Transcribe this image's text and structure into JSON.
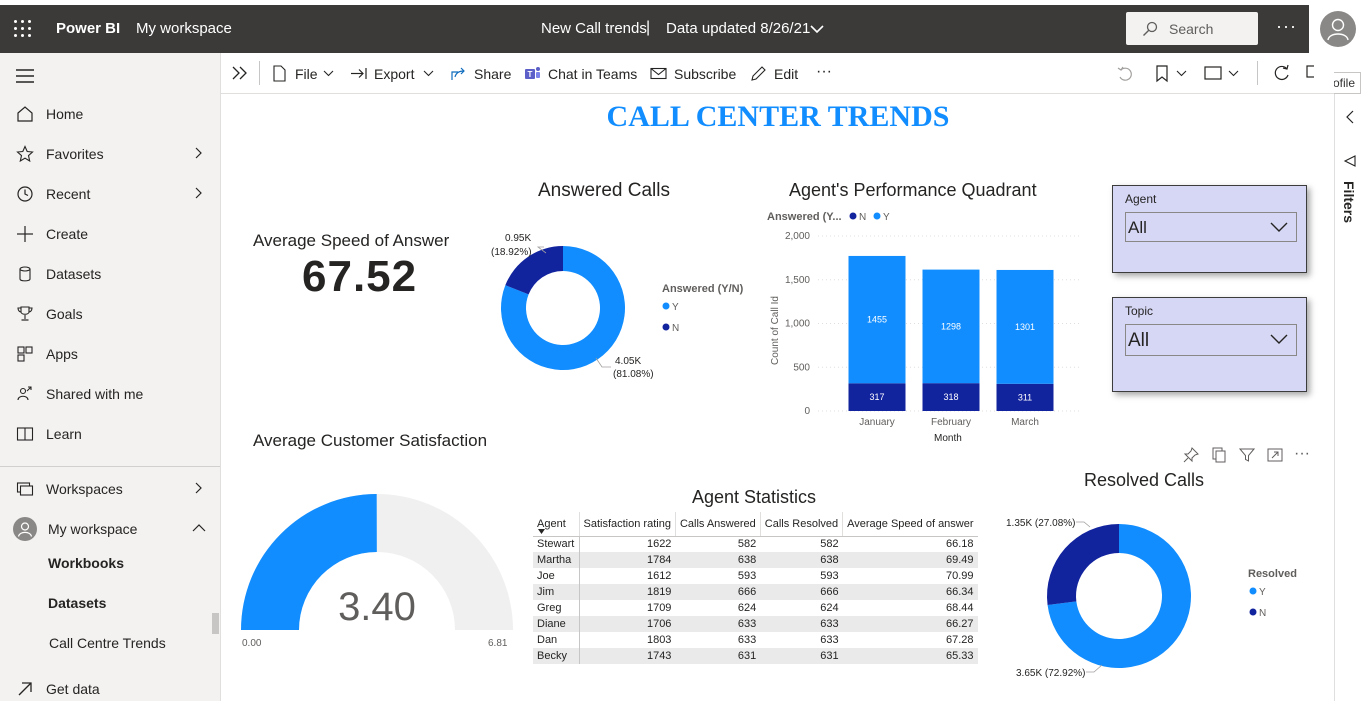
{
  "app": {
    "brand": "Power BI",
    "workspace": "My workspace",
    "report_title": "New Call trends",
    "separator": "|",
    "data_updated": "Data updated 8/26/21",
    "search_placeholder": "Search",
    "more": "···",
    "profile_tooltip": "Profile"
  },
  "nav": {
    "items": [
      {
        "label": "Home",
        "icon": "home-icon"
      },
      {
        "label": "Favorites",
        "icon": "star-icon"
      },
      {
        "label": "Recent",
        "icon": "clock-icon"
      },
      {
        "label": "Create",
        "icon": "plus-icon"
      },
      {
        "label": "Datasets",
        "icon": "database-icon"
      },
      {
        "label": "Goals",
        "icon": "trophy-icon"
      },
      {
        "label": "Apps",
        "icon": "apps-icon"
      },
      {
        "label": "Shared with me",
        "icon": "shared-icon"
      },
      {
        "label": "Learn",
        "icon": "book-icon"
      },
      {
        "label": "Workspaces",
        "icon": "workspaces-icon"
      },
      {
        "label": "My workspace",
        "icon": "avatar-icon"
      }
    ],
    "sub_items": [
      "Workbooks",
      "Datasets",
      "Call Centre Trends"
    ],
    "get_data": "Get data"
  },
  "toolbar": {
    "file": "File",
    "export": "Export",
    "share": "Share",
    "chat": "Chat in Teams",
    "subscribe": "Subscribe",
    "edit": "Edit",
    "more": "···"
  },
  "filters_label": "Filters",
  "report": {
    "title": "CALL CENTER TRENDS",
    "asa_title": "Average Speed of Answer",
    "asa_value": "67.52",
    "answered_title": "Answered Calls",
    "quadrant_title": "Agent's Performance Quadrant",
    "csat_title": "Average Customer Satisfaction",
    "stats_title": "Agent Statistics",
    "resolved_title": "Resolved Calls",
    "slicer_agent": {
      "header": "Agent",
      "value": "All"
    },
    "slicer_topic": {
      "header": "Topic",
      "value": "All"
    }
  },
  "colors": {
    "light_blue": "#118dff",
    "dark_blue": "#12239e",
    "gauge_bg": "#f0f0f0",
    "slicer_bg": "#d6d6f5"
  },
  "chart_data": [
    {
      "type": "pie",
      "title": "Answered Calls",
      "legend_title": "Answered (Y/N)",
      "legend_position": "right",
      "categories": [
        "Y",
        "N"
      ],
      "values": [
        4.05,
        0.95
      ],
      "labels": [
        "4.05K",
        "0.95K"
      ],
      "percent_labels": [
        "(81.08%)",
        "(18.92%)"
      ],
      "donut": true
    },
    {
      "type": "bar",
      "stacked": true,
      "title": "Agent's Performance Quadrant",
      "legend_title": "Answered (Y...",
      "legend_position": "top-left",
      "categories": [
        "January",
        "February",
        "March"
      ],
      "xlabel": "Month",
      "ylabel": "Count of Call Id",
      "ylim": [
        0,
        2000
      ],
      "yticks": [
        "0",
        "500",
        "1,000",
        "1,500",
        "2,000"
      ],
      "series": [
        {
          "name": "N",
          "values": [
            317,
            318,
            311
          ]
        },
        {
          "name": "Y",
          "values": [
            1455,
            1298,
            1301
          ]
        }
      ]
    },
    {
      "type": "gauge",
      "title": "Average Customer Satisfaction",
      "value": 3.4,
      "value_label": "3.40",
      "min": 0,
      "max": 6.81,
      "min_label": "0.00",
      "max_label": "6.81"
    },
    {
      "type": "table",
      "title": "Agent Statistics",
      "columns": [
        "Agent",
        "Satisfaction rating",
        "Calls Answered",
        "Calls Resolved",
        "Average Speed of answer"
      ],
      "rows": [
        [
          "Stewart",
          "1622",
          "582",
          "582",
          "66.18"
        ],
        [
          "Martha",
          "1784",
          "638",
          "638",
          "69.49"
        ],
        [
          "Joe",
          "1612",
          "593",
          "593",
          "70.99"
        ],
        [
          "Jim",
          "1819",
          "666",
          "666",
          "66.34"
        ],
        [
          "Greg",
          "1709",
          "624",
          "624",
          "68.44"
        ],
        [
          "Diane",
          "1706",
          "633",
          "633",
          "66.27"
        ],
        [
          "Dan",
          "1803",
          "633",
          "633",
          "67.28"
        ],
        [
          "Becky",
          "1743",
          "631",
          "631",
          "65.33"
        ]
      ]
    },
    {
      "type": "pie",
      "title": "Resolved Calls",
      "legend_title": "Resolved",
      "legend_position": "right",
      "categories": [
        "Y",
        "N"
      ],
      "values": [
        3.65,
        1.35
      ],
      "labels": [
        "3.65K (72.92%)",
        "1.35K (27.08%)"
      ],
      "donut": true
    }
  ]
}
